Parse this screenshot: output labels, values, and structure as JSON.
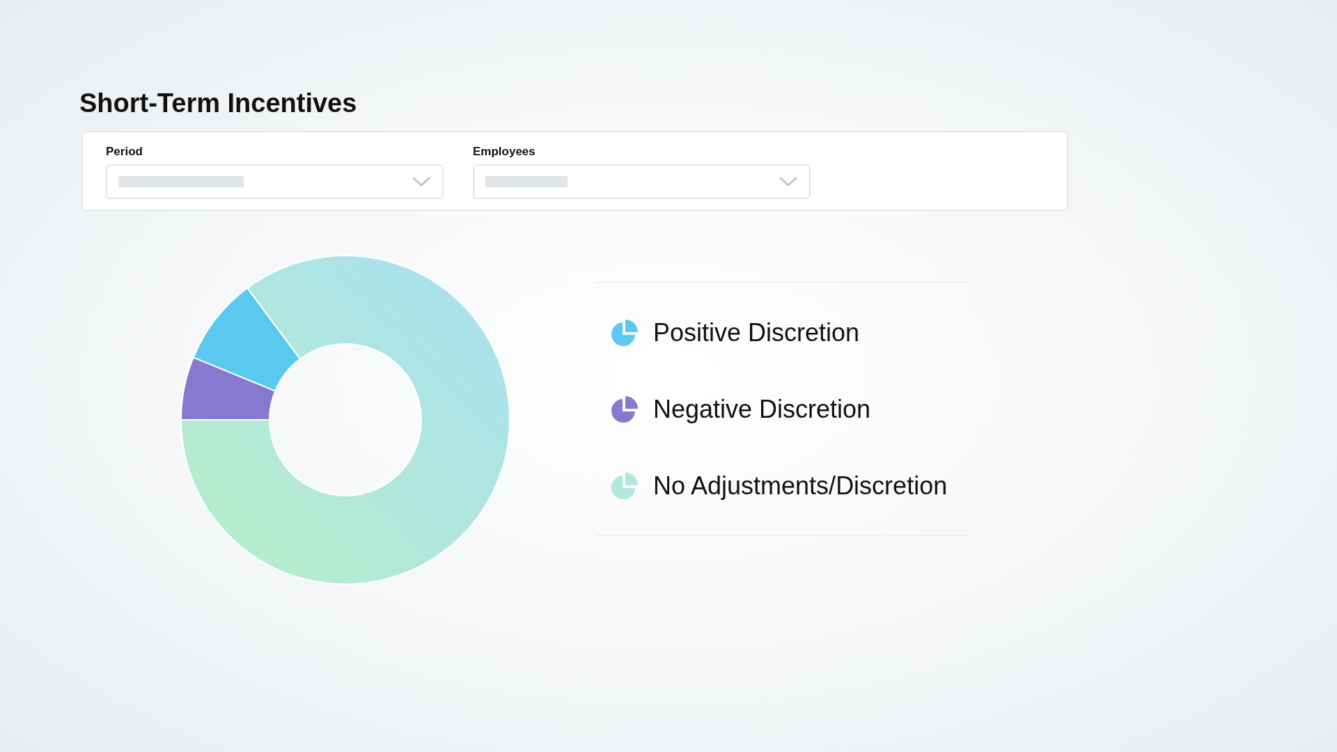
{
  "title": "Short-Term Incentives",
  "filters": [
    {
      "label": "Period"
    },
    {
      "label": "Employees"
    }
  ],
  "legend": [
    {
      "label": "Positive Discretion",
      "color": "#5bc8f0"
    },
    {
      "label": "Negative Discretion",
      "color": "#8778d0"
    },
    {
      "label": "No Adjustments/Discretion",
      "color": "#b0e8dc"
    }
  ]
}
